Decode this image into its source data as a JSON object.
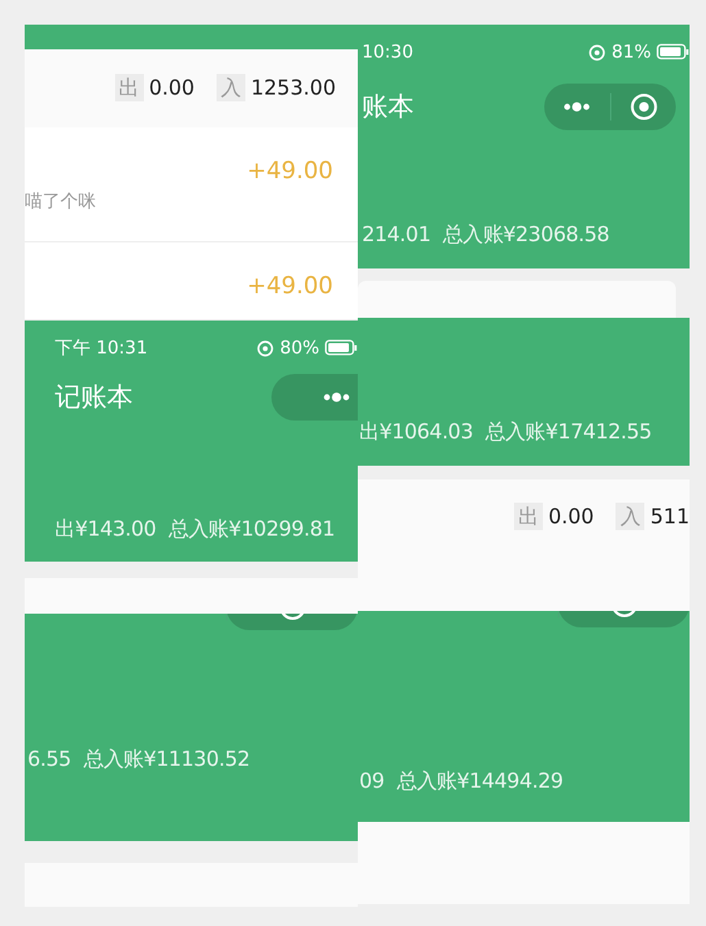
{
  "left_column": [
    {
      "kind": "list",
      "summary": {
        "out_label": "出",
        "out": "0.00",
        "in_label": "入",
        "in": "1253.00"
      },
      "entries": [
        {
          "amount": "+49.00",
          "note": "喵了个咪"
        },
        {
          "amount": "+49.00"
        }
      ]
    },
    {
      "kind": "header",
      "status": {
        "time": "下午 10:31",
        "battery": "80%"
      },
      "title": "记账本",
      "capsule": true,
      "totals": [
        "出¥143.00",
        "总入账¥10299.81"
      ]
    },
    {
      "kind": "header",
      "capsule": true,
      "totals": [
        "6.55",
        "总入账¥11130.52"
      ]
    }
  ],
  "right_column": [
    {
      "kind": "header",
      "status": {
        "time": "10:30",
        "battery": "81%"
      },
      "title": "账本",
      "capsule": true,
      "totals": [
        "214.01",
        "总入账¥23068.58"
      ]
    },
    {
      "kind": "header",
      "totals": [
        "出¥1064.03",
        "总入账¥17412.55"
      ],
      "summary": {
        "out_label": "出",
        "out": "0.00",
        "in_label": "入",
        "in": "511"
      }
    },
    {
      "kind": "header",
      "capsule": true,
      "totals": [
        "09",
        "总入账¥14494.29"
      ]
    }
  ]
}
